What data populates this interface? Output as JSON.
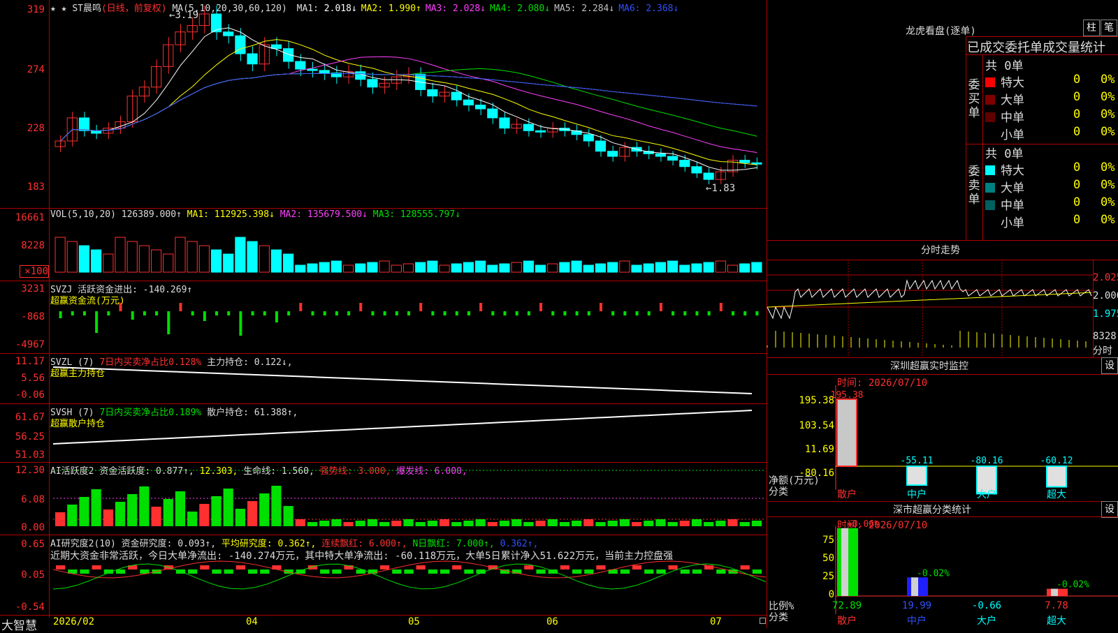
{
  "main": {
    "stock": "ST晨鸣",
    "period": "(日线，前复权)",
    "ma_label": "MA(5,10,20,30,60,120)",
    "ma": [
      {
        "label": "MA1:",
        "value": "2.018↓",
        "color": "#ffffff"
      },
      {
        "label": "MA2:",
        "value": "1.990↑",
        "color": "#ffff00"
      },
      {
        "label": "MA3:",
        "value": "2.028↓",
        "color": "#ff40ff"
      },
      {
        "label": "MA4:",
        "value": "2.080↓",
        "color": "#00e000"
      },
      {
        "label": "MA5:",
        "value": "2.284↓",
        "color": "#c0c0c0"
      },
      {
        "label": "MA6:",
        "value": "2.368↓",
        "color": "#3050ff"
      }
    ],
    "y_ticks": [
      "319",
      "274",
      "228",
      "183"
    ],
    "high_mark": "3.19",
    "low_mark": "1.83"
  },
  "vol": {
    "label": "VOL(5,10,20)",
    "value": "126389.000↑",
    "ma1": "MA1: 112925.398↓",
    "ma2": "MA2: 135679.500↓",
    "ma3": "MA3: 128555.797↓",
    "y_ticks": [
      "16661",
      "8228",
      "×100"
    ]
  },
  "svzj": {
    "name": "SVZJ",
    "label": "活跃资金进出:",
    "value": "-140.269↑",
    "sub": "超赢资金流(万元)",
    "y_ticks": [
      "3231",
      "-868",
      "-4967"
    ]
  },
  "svzl": {
    "name": "SVZL (7)",
    "ratio": "7日内买卖净占比0.128%",
    "label": "主力持仓:",
    "value": "0.122↓,",
    "sub": "超赢主力持仓",
    "y_ticks": [
      "11.17",
      "5.56",
      "-0.06"
    ]
  },
  "svsh": {
    "name": "SVSH (7)",
    "ratio": "7日内买卖净占比0.189%",
    "label": "散户持仓:",
    "value": "61.388↑,",
    "sub": "超赢散户持仓",
    "y_ticks": [
      "61.67",
      "56.25",
      "51.03"
    ]
  },
  "ai1": {
    "name": "AI活跃度2",
    "items": [
      "资金活跃度: 0.877↑,",
      "12.303,",
      "生命线: 1.560,",
      "强势线: 3.000,",
      "爆发线: 6.000,"
    ],
    "y_ticks": [
      "12.30",
      "6.08",
      "0.00"
    ]
  },
  "ai2": {
    "name": "AI研究度2(10)",
    "items": [
      "资金研究度: 0.093↑,",
      "平均研究度: 0.362↑,",
      "连续飘红: 6.000↑,",
      "N日飘红: 7.000↑,",
      "0.362↑,"
    ],
    "summary": "近期大资金非常活跃，今日大单净流出: -140.274万元，其中特大单净流出: -60.118万元，大单5日累计净入51.622万元，当前主力控盘强",
    "y_ticks": [
      "0.65",
      "0.05",
      "-0.54"
    ]
  },
  "bottom": {
    "brand": "大智慧",
    "dates": [
      "2026/02",
      "04",
      "05",
      "06",
      "07"
    ]
  },
  "right": {
    "lhb_title": "龙虎看盘(逐单)",
    "btn_zhu": "柱",
    "btn_bi": "笔",
    "stats_title": "已成交委托单成交量统计",
    "buy": {
      "label": "委买单",
      "count": "共 0单",
      "rows": [
        {
          "name": "特大",
          "v": "0",
          "p": "0%",
          "color": "#ff0000"
        },
        {
          "name": "大单",
          "v": "0",
          "p": "0%",
          "color": "#800000"
        },
        {
          "name": "中单",
          "v": "0",
          "p": "0%",
          "color": "#600000"
        },
        {
          "name": "小单",
          "v": "0",
          "p": "0%",
          "color": "#000000"
        }
      ]
    },
    "sell": {
      "label": "委卖单",
      "count": "共 0单",
      "rows": [
        {
          "name": "特大",
          "v": "0",
          "p": "0%",
          "color": "#00ffff"
        },
        {
          "name": "大单",
          "v": "0",
          "p": "0%",
          "color": "#008080"
        },
        {
          "name": "中单",
          "v": "0",
          "p": "0%",
          "color": "#006060"
        },
        {
          "name": "小单",
          "v": "0",
          "p": "0%",
          "color": "#000000"
        }
      ]
    },
    "fenshi_title": "分时走势",
    "fenshi_ticks": [
      "2.025",
      "2.000",
      "1.975",
      "8328",
      "分时"
    ],
    "sz_title": "深圳超赢实时监控",
    "sz_btn": "设",
    "sz_time": "时间: 2026/07/10",
    "sz_ticks": [
      "195.38",
      "103.54",
      "11.69",
      "-80.16"
    ],
    "sz_axis_label": "净额(万元)",
    "sz_axis_sub": "分类",
    "sz_bars": [
      {
        "cat": "散户",
        "val": "195.38"
      },
      {
        "cat": "中户",
        "val": "-55.11"
      },
      {
        "cat": "大户",
        "val": "-80.16"
      },
      {
        "cat": "超大",
        "val": "-60.12"
      }
    ],
    "cls_title": "深市超赢分类统计",
    "cls_btn": "设",
    "cls_time": "时间: 2026/07/10",
    "cls_ticks": [
      "75",
      "50",
      "25",
      "0"
    ],
    "cls_axis_label": "比例%",
    "cls_axis_sub": "分类",
    "cls_bars": [
      {
        "cat": "散户",
        "top": "+0.06%",
        "bot": "72.89"
      },
      {
        "cat": "中户",
        "top": "-0.02%",
        "bot": "19.99"
      },
      {
        "cat": "大户",
        "top": "",
        "bot": "-0.66"
      },
      {
        "cat": "超大",
        "top": "-0.02%",
        "bot": "7.78"
      }
    ]
  },
  "chart_data": {
    "type": "candlestick",
    "price_range": [
      1.83,
      3.19
    ],
    "close": [
      2.2,
      2.38,
      2.28,
      2.26,
      2.3,
      2.35,
      2.55,
      2.62,
      2.78,
      2.95,
      3.05,
      3.1,
      3.19,
      3.05,
      3.02,
      2.88,
      2.8,
      2.95,
      2.92,
      2.82,
      2.76,
      2.75,
      2.73,
      2.7,
      2.74,
      2.68,
      2.62,
      2.65,
      2.7,
      2.72,
      2.6,
      2.55,
      2.58,
      2.52,
      2.48,
      2.45,
      2.38,
      2.3,
      2.33,
      2.28,
      2.27,
      2.3,
      2.28,
      2.25,
      2.2,
      2.12,
      2.08,
      2.15,
      2.12,
      2.1,
      2.08,
      2.05,
      2.0,
      1.95,
      1.9,
      1.96,
      2.05,
      2.03,
      2.02
    ],
    "colors": {
      "up": "#ff3030",
      "down": "#00ffff"
    }
  }
}
